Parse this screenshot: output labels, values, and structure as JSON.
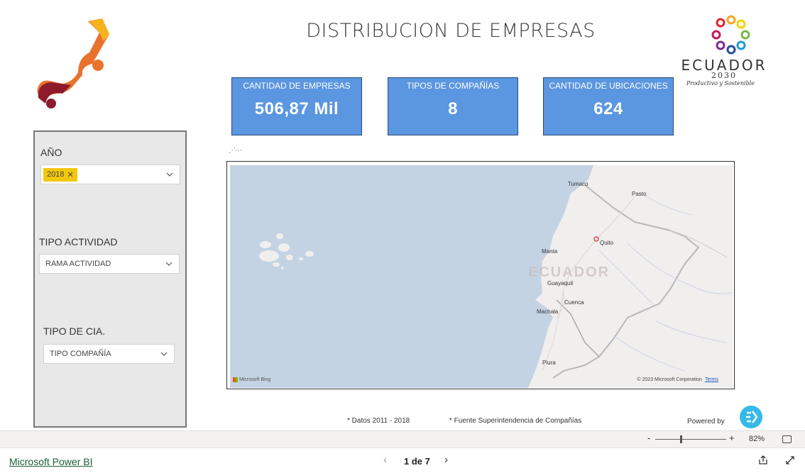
{
  "report": {
    "title": "DISTRIBUCION DE EMPRESAS"
  },
  "ecuador_logo": {
    "word": "ECUADOR",
    "year": "2030",
    "subtitle": "Productivo y Sostenible"
  },
  "kpis": [
    {
      "label": "CANTIDAD DE EMPRESAS",
      "value": "506,87 Mil"
    },
    {
      "label": "TIPOS DE COMPAÑÍAS",
      "value": "8"
    },
    {
      "label": "CANTIDAD DE UBICACIONES",
      "value": "624"
    }
  ],
  "filters": {
    "year": {
      "label": "AÑO",
      "selected_chip": "2018",
      "chip_remove": "✕"
    },
    "activity": {
      "label": "TIPO ACTIVIDAD",
      "placeholder": "RAMA ACTIVIDAD"
    },
    "company_type": {
      "label": "TIPO DE CIA.",
      "placeholder": "TIPO COMPAÑÍA"
    }
  },
  "map": {
    "country_label": "ECUADOR",
    "cities": [
      "Tumaco",
      "Pasto",
      "Quito",
      "Manta",
      "Guayaquil",
      "Cuenca",
      "Machala",
      "Piura"
    ],
    "attribution": "Microsoft Bing",
    "copyright": "© 2023 Microsoft Corporation",
    "terms": "Terms",
    "ocean_color": "#c3d3e3",
    "land_color": "#f1eeee"
  },
  "notes": {
    "data_range": "* Datos 2011 - 2018",
    "source": "* Fuente Superintendencia de Compañías",
    "powered_by": "Powered by"
  },
  "zoom": {
    "minus": "-",
    "plus": "+",
    "percent": "82%",
    "level": 0.82
  },
  "footer": {
    "brand": "Microsoft Power BI",
    "page": "1 de 7",
    "prev": "‹",
    "next": "›"
  },
  "colors": {
    "kpi_fill": "#5b96e0",
    "chip": "#f2c80f",
    "panel": "#e8e8e8"
  }
}
